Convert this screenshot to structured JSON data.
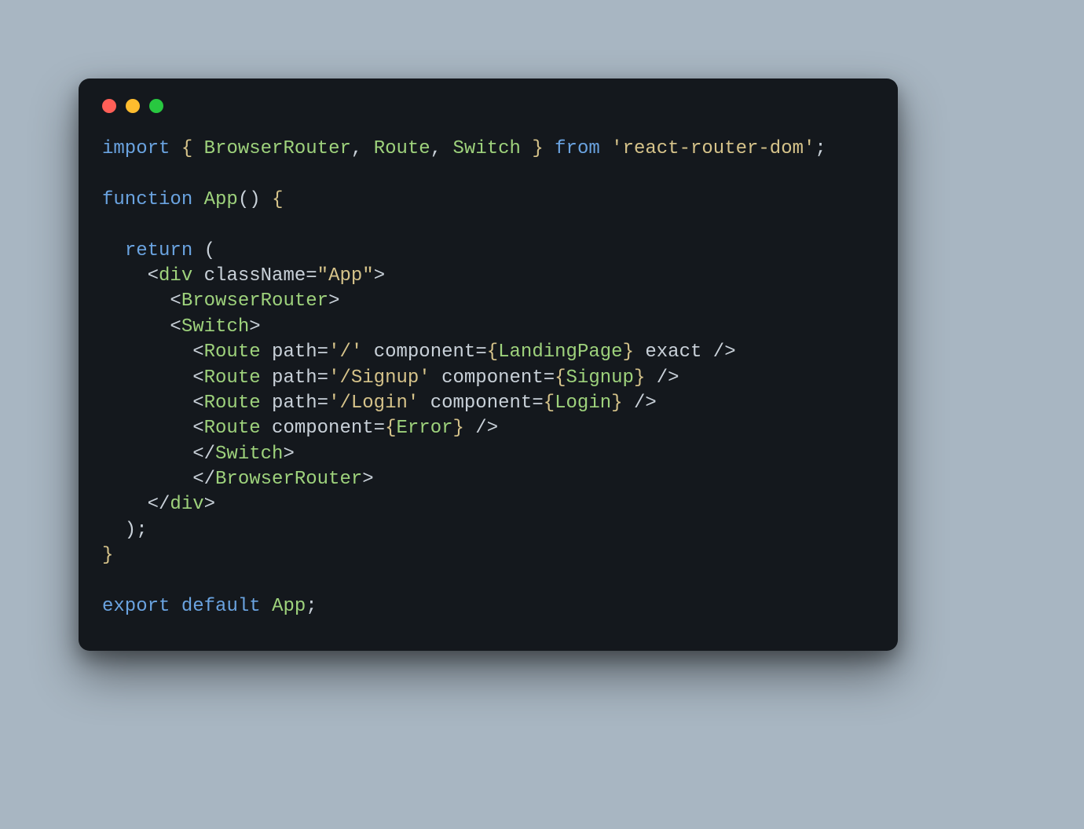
{
  "colors": {
    "background_page": "#a8b6c2",
    "background_window": "#14181d",
    "dot_red": "#ff5f57",
    "dot_yellow": "#febc2e",
    "dot_green": "#28c840",
    "text_default": "#c9d1d9",
    "text_keyword": "#6aa3e0",
    "text_identifier": "#9ed27c",
    "text_string": "#d6c38a"
  },
  "window_controls": {
    "close": "close",
    "minimize": "minimize",
    "maximize": "maximize"
  },
  "code": {
    "raw": "import { BrowserRouter, Route, Switch } from 'react-router-dom';\n\nfunction App() {\n\n  return (\n    <div className=\"App\">\n      <BrowserRouter>\n      <Switch>\n        <Route path='/' component={LandingPage} exact />\n        <Route path='/Signup' component={Signup} />\n        <Route path='/Login' component={Login} />\n        <Route component={Error} />\n        </Switch>\n        </BrowserRouter>\n    </div>\n  );\n}\n\nexport default App;",
    "tokens": [
      [
        {
          "t": "import",
          "c": "kw"
        },
        {
          "t": " ",
          "c": "punc"
        },
        {
          "t": "{",
          "c": "brk"
        },
        {
          "t": " ",
          "c": "punc"
        },
        {
          "t": "BrowserRouter",
          "c": "ident"
        },
        {
          "t": ", ",
          "c": "punc"
        },
        {
          "t": "Route",
          "c": "ident"
        },
        {
          "t": ", ",
          "c": "punc"
        },
        {
          "t": "Switch",
          "c": "ident"
        },
        {
          "t": " ",
          "c": "punc"
        },
        {
          "t": "}",
          "c": "brk"
        },
        {
          "t": " ",
          "c": "punc"
        },
        {
          "t": "from",
          "c": "kw"
        },
        {
          "t": " ",
          "c": "punc"
        },
        {
          "t": "'react-router-dom'",
          "c": "str"
        },
        {
          "t": ";",
          "c": "punc"
        }
      ],
      [],
      [
        {
          "t": "function",
          "c": "kw"
        },
        {
          "t": " ",
          "c": "punc"
        },
        {
          "t": "App",
          "c": "ident"
        },
        {
          "t": "()",
          "c": "punc"
        },
        {
          "t": " ",
          "c": "punc"
        },
        {
          "t": "{",
          "c": "brk"
        }
      ],
      [],
      [
        {
          "t": "  ",
          "c": "punc"
        },
        {
          "t": "return",
          "c": "kw"
        },
        {
          "t": " (",
          "c": "punc"
        }
      ],
      [
        {
          "t": "    ",
          "c": "punc"
        },
        {
          "t": "<",
          "c": "punc"
        },
        {
          "t": "div",
          "c": "tag"
        },
        {
          "t": " ",
          "c": "punc"
        },
        {
          "t": "className",
          "c": "attr"
        },
        {
          "t": "=",
          "c": "punc"
        },
        {
          "t": "\"App\"",
          "c": "str"
        },
        {
          "t": ">",
          "c": "punc"
        }
      ],
      [
        {
          "t": "      ",
          "c": "punc"
        },
        {
          "t": "<",
          "c": "punc"
        },
        {
          "t": "BrowserRouter",
          "c": "tag"
        },
        {
          "t": ">",
          "c": "punc"
        }
      ],
      [
        {
          "t": "      ",
          "c": "punc"
        },
        {
          "t": "<",
          "c": "punc"
        },
        {
          "t": "Switch",
          "c": "tag"
        },
        {
          "t": ">",
          "c": "punc"
        }
      ],
      [
        {
          "t": "        ",
          "c": "punc"
        },
        {
          "t": "<",
          "c": "punc"
        },
        {
          "t": "Route",
          "c": "tag"
        },
        {
          "t": " ",
          "c": "punc"
        },
        {
          "t": "path",
          "c": "attr"
        },
        {
          "t": "=",
          "c": "punc"
        },
        {
          "t": "'/'",
          "c": "str"
        },
        {
          "t": " ",
          "c": "punc"
        },
        {
          "t": "component",
          "c": "attr"
        },
        {
          "t": "=",
          "c": "punc"
        },
        {
          "t": "{",
          "c": "brk"
        },
        {
          "t": "LandingPage",
          "c": "ident"
        },
        {
          "t": "}",
          "c": "brk"
        },
        {
          "t": " ",
          "c": "punc"
        },
        {
          "t": "exact",
          "c": "attr"
        },
        {
          "t": " />",
          "c": "punc"
        }
      ],
      [
        {
          "t": "        ",
          "c": "punc"
        },
        {
          "t": "<",
          "c": "punc"
        },
        {
          "t": "Route",
          "c": "tag"
        },
        {
          "t": " ",
          "c": "punc"
        },
        {
          "t": "path",
          "c": "attr"
        },
        {
          "t": "=",
          "c": "punc"
        },
        {
          "t": "'/Signup'",
          "c": "str"
        },
        {
          "t": " ",
          "c": "punc"
        },
        {
          "t": "component",
          "c": "attr"
        },
        {
          "t": "=",
          "c": "punc"
        },
        {
          "t": "{",
          "c": "brk"
        },
        {
          "t": "Signup",
          "c": "ident"
        },
        {
          "t": "}",
          "c": "brk"
        },
        {
          "t": " />",
          "c": "punc"
        }
      ],
      [
        {
          "t": "        ",
          "c": "punc"
        },
        {
          "t": "<",
          "c": "punc"
        },
        {
          "t": "Route",
          "c": "tag"
        },
        {
          "t": " ",
          "c": "punc"
        },
        {
          "t": "path",
          "c": "attr"
        },
        {
          "t": "=",
          "c": "punc"
        },
        {
          "t": "'/Login'",
          "c": "str"
        },
        {
          "t": " ",
          "c": "punc"
        },
        {
          "t": "component",
          "c": "attr"
        },
        {
          "t": "=",
          "c": "punc"
        },
        {
          "t": "{",
          "c": "brk"
        },
        {
          "t": "Login",
          "c": "ident"
        },
        {
          "t": "}",
          "c": "brk"
        },
        {
          "t": " />",
          "c": "punc"
        }
      ],
      [
        {
          "t": "        ",
          "c": "punc"
        },
        {
          "t": "<",
          "c": "punc"
        },
        {
          "t": "Route",
          "c": "tag"
        },
        {
          "t": " ",
          "c": "punc"
        },
        {
          "t": "component",
          "c": "attr"
        },
        {
          "t": "=",
          "c": "punc"
        },
        {
          "t": "{",
          "c": "brk"
        },
        {
          "t": "Error",
          "c": "ident"
        },
        {
          "t": "}",
          "c": "brk"
        },
        {
          "t": " />",
          "c": "punc"
        }
      ],
      [
        {
          "t": "        ",
          "c": "punc"
        },
        {
          "t": "</",
          "c": "punc"
        },
        {
          "t": "Switch",
          "c": "tag"
        },
        {
          "t": ">",
          "c": "punc"
        }
      ],
      [
        {
          "t": "        ",
          "c": "punc"
        },
        {
          "t": "</",
          "c": "punc"
        },
        {
          "t": "BrowserRouter",
          "c": "tag"
        },
        {
          "t": ">",
          "c": "punc"
        }
      ],
      [
        {
          "t": "    ",
          "c": "punc"
        },
        {
          "t": "</",
          "c": "punc"
        },
        {
          "t": "div",
          "c": "tag"
        },
        {
          "t": ">",
          "c": "punc"
        }
      ],
      [
        {
          "t": "  );",
          "c": "punc"
        }
      ],
      [
        {
          "t": "}",
          "c": "brk"
        }
      ],
      [],
      [
        {
          "t": "export",
          "c": "kw"
        },
        {
          "t": " ",
          "c": "punc"
        },
        {
          "t": "default",
          "c": "kw"
        },
        {
          "t": " ",
          "c": "punc"
        },
        {
          "t": "App",
          "c": "ident"
        },
        {
          "t": ";",
          "c": "punc"
        }
      ]
    ]
  }
}
